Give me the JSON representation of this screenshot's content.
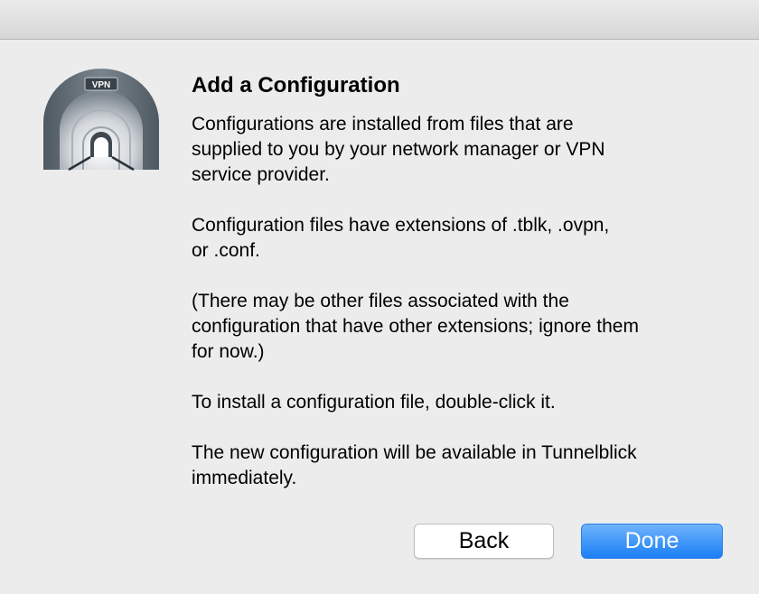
{
  "dialog": {
    "heading": "Add a Configuration",
    "paragraphs": [
      "Configurations are installed from files that are\nsupplied to you by your network manager or VPN\nservice provider.",
      "Configuration files have extensions of .tblk, .ovpn,\nor .conf.",
      "(There may be other files associated with the\nconfiguration that have other extensions; ignore them\nfor now.)",
      "To install a configuration file, double-click it.",
      "The new configuration will be available in Tunnelblick\nimmediately."
    ],
    "icon": {
      "name": "tunnelblick-vpn-tunnel-icon",
      "badge_text": "VPN"
    }
  },
  "buttons": {
    "back_label": "Back",
    "done_label": "Done"
  },
  "colors": {
    "window_bg": "#ececec",
    "primary_button": "#1a7ff6",
    "icon_gray": "#5c6670"
  }
}
